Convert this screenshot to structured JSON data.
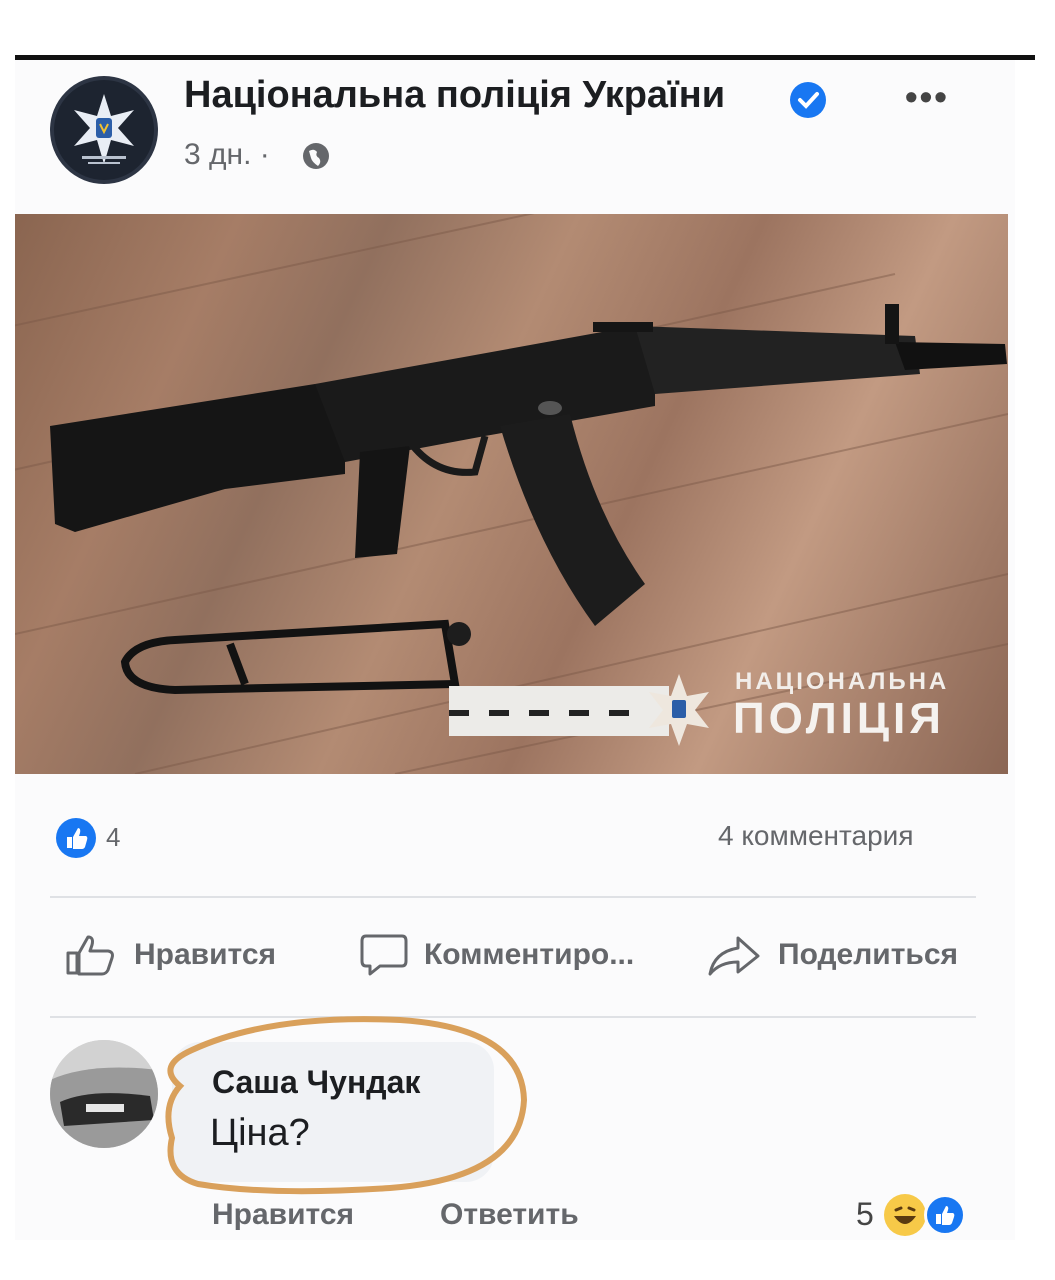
{
  "post": {
    "page_name": "Національна поліція України",
    "time": "3 дн. ·",
    "icons": {
      "avatar": "police-emblem-icon",
      "verified": "verified-badge-icon",
      "more": "more-options-icon",
      "privacy": "globe-icon"
    }
  },
  "photo": {
    "watermark_line1": "НАЦІОНАЛЬНА",
    "watermark_line2": "ПОЛІЦІЯ"
  },
  "stats": {
    "reactions": "4",
    "comments": "4 комментария"
  },
  "actions": {
    "like": "Нравится",
    "comment": "Комментиро...",
    "share": "Поделиться"
  },
  "comment": {
    "author": "Саша Чундак",
    "text": "Ціна?",
    "like": "Нравится",
    "reply": "Ответить",
    "reaction_count": "5",
    "reactions": [
      "haha-icon",
      "like-icon"
    ]
  },
  "colors": {
    "brand": "#1877f2",
    "highlight": "#d9a05b"
  }
}
